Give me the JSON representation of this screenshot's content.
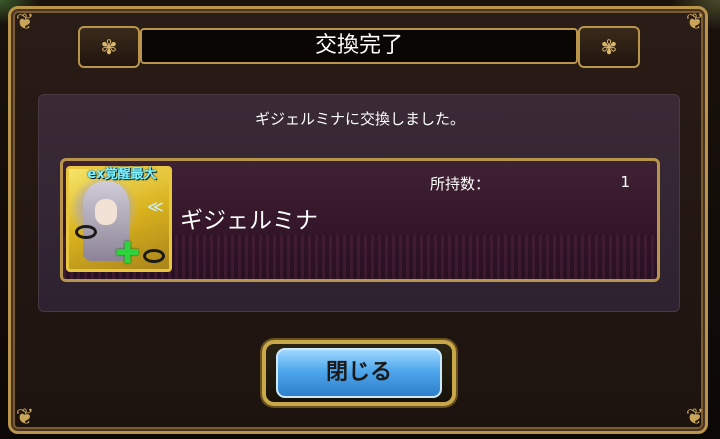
{
  "dialog": {
    "title": "交換完了",
    "message": "ギジェルミナに交換しました。"
  },
  "item": {
    "badge": "ex覚醒最大",
    "name": "ギジェルミナ",
    "owned_label": "所持数：",
    "owned_value": "1"
  },
  "buttons": {
    "close_label": "閉じる"
  },
  "colors": {
    "frame_gold": "#b9954c",
    "panel_purple": "#2e2230",
    "button_blue": "#4fa7ec",
    "badge_cyan": "#7cf2ff"
  },
  "icons": {
    "corner": "flourish-ornament-icon",
    "title_ornament": "scroll-ornament-icon",
    "plus": "plus-icon",
    "chevron": "double-chevron-icon"
  }
}
